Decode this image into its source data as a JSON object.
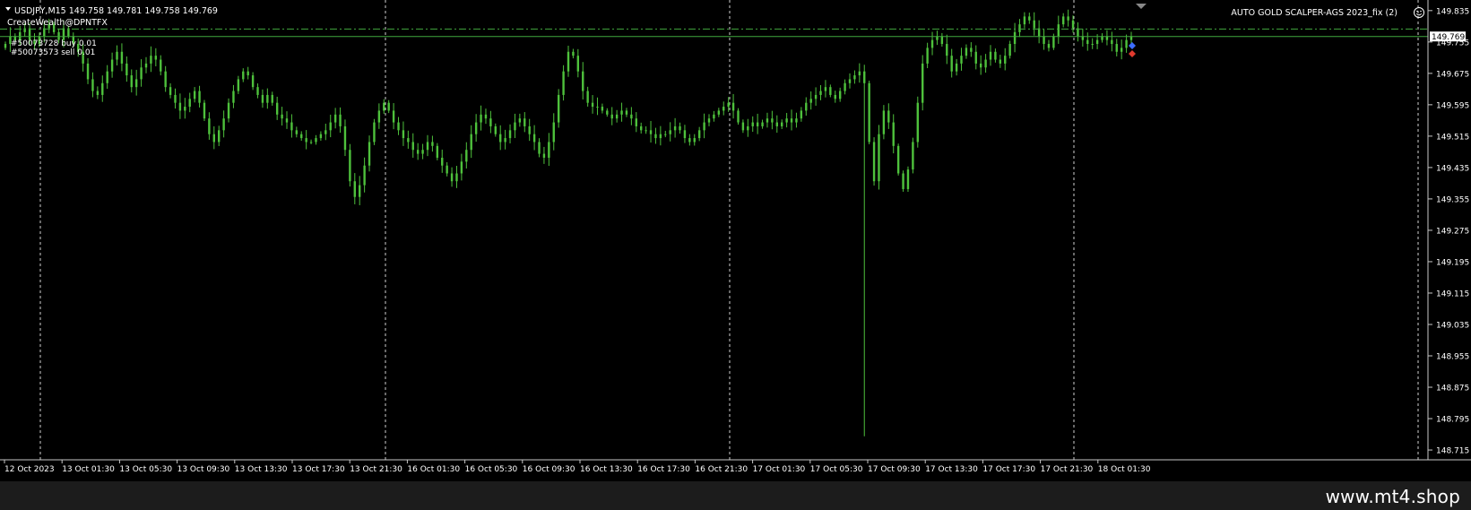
{
  "header": {
    "symbol_line": "USDJPY,M15  149.758 149.781 149.758 149.769",
    "account_line": "CreateWealth@DPNTFX",
    "expert_name": "AUTO GOLD SCALPER-AGS 2023_fix (2)",
    "order_label_1": "#50073728 buy 0.01",
    "order_label_2": "#50073573 sell 0.01"
  },
  "watermark": "www.mt4.shop",
  "colors": {
    "background": "#000000",
    "candle": "#4ec13c",
    "grid": "#c8c8c8",
    "axis_text": "#ffffff",
    "price_line": "#41a83e",
    "price_tag_bg": "#ffffff",
    "price_tag_text": "#000000"
  },
  "chart_data": {
    "type": "candlestick",
    "title": "USDJPY,M15",
    "instrument": "USDJPY",
    "timeframe": "M15",
    "last_ohlc": {
      "open": 149.758,
      "high": 149.781,
      "low": 149.758,
      "close": 149.769
    },
    "current_price": 149.769,
    "current_price_label": "149.769",
    "order_lines": [
      {
        "label": "#50073728 buy 0.01",
        "price": 149.788
      },
      {
        "label": "#50073573 sell 0.01",
        "price": 149.769
      }
    ],
    "ylim": [
      148.69,
      149.862
    ],
    "y_ticks": [
      "149.835",
      "149.755",
      "149.675",
      "149.595",
      "149.515",
      "149.435",
      "149.355",
      "149.275",
      "149.195",
      "149.115",
      "149.035",
      "148.955",
      "148.875",
      "148.795",
      "148.715"
    ],
    "x_ticks": [
      "12 Oct 2023",
      "13 Oct 01:30",
      "13 Oct 05:30",
      "13 Oct 09:30",
      "13 Oct 13:30",
      "13 Oct 17:30",
      "13 Oct 21:30",
      "16 Oct 01:30",
      "16 Oct 05:30",
      "16 Oct 09:30",
      "16 Oct 13:30",
      "16 Oct 17:30",
      "16 Oct 21:30",
      "17 Oct 01:30",
      "17 Oct 05:30",
      "17 Oct 09:30",
      "17 Oct 13:30",
      "17 Oct 17:30",
      "17 Oct 21:30",
      "18 Oct 01:30"
    ],
    "grid": "vertical day separators",
    "close_path": [
      149.75,
      149.77,
      149.76,
      149.78,
      149.79,
      149.76,
      149.75,
      149.77,
      149.79,
      149.8,
      149.78,
      149.76,
      149.79,
      149.77,
      149.75,
      149.73,
      149.7,
      149.66,
      149.63,
      149.62,
      149.65,
      149.68,
      149.71,
      149.73,
      149.7,
      149.67,
      149.64,
      149.66,
      149.69,
      149.7,
      149.72,
      149.71,
      149.68,
      149.64,
      149.62,
      149.6,
      149.58,
      149.59,
      149.61,
      149.63,
      149.6,
      149.56,
      149.52,
      149.5,
      149.53,
      149.56,
      149.6,
      149.63,
      149.66,
      149.68,
      149.67,
      149.64,
      149.62,
      149.6,
      149.62,
      149.6,
      149.57,
      149.56,
      149.55,
      149.53,
      149.52,
      149.51,
      149.5,
      149.5,
      149.51,
      149.52,
      149.53,
      149.55,
      149.57,
      149.54,
      149.48,
      149.4,
      149.36,
      149.39,
      149.44,
      149.5,
      149.55,
      149.58,
      149.6,
      149.58,
      149.55,
      149.53,
      149.51,
      149.5,
      149.48,
      149.47,
      149.48,
      149.5,
      149.49,
      149.46,
      149.44,
      149.42,
      149.4,
      149.42,
      149.45,
      149.48,
      149.52,
      149.55,
      149.57,
      149.56,
      149.54,
      149.52,
      149.5,
      149.51,
      149.53,
      149.55,
      149.56,
      149.54,
      149.52,
      149.5,
      149.47,
      149.46,
      149.5,
      149.55,
      149.62,
      149.68,
      149.73,
      149.72,
      149.68,
      149.63,
      149.6,
      149.59,
      149.59,
      149.58,
      149.57,
      149.56,
      149.57,
      149.58,
      149.57,
      149.56,
      149.54,
      149.53,
      149.53,
      149.52,
      149.51,
      149.52,
      149.52,
      149.53,
      149.54,
      149.53,
      149.51,
      149.5,
      149.51,
      149.53,
      149.55,
      149.56,
      149.57,
      149.58,
      149.59,
      149.6,
      149.58,
      149.55,
      149.53,
      149.54,
      149.55,
      149.54,
      149.55,
      149.56,
      149.55,
      149.54,
      149.55,
      149.56,
      149.55,
      149.56,
      149.58,
      149.6,
      149.61,
      149.62,
      149.63,
      149.64,
      149.62,
      149.61,
      149.63,
      149.65,
      149.66,
      149.67,
      149.68,
      149.65,
      149.5,
      149.4,
      149.52,
      149.58,
      149.55,
      149.49,
      149.42,
      149.38,
      149.43,
      149.5,
      149.6,
      149.7,
      149.74,
      149.76,
      149.77,
      149.75,
      149.72,
      149.68,
      149.7,
      149.72,
      149.74,
      149.73,
      149.7,
      149.69,
      149.71,
      149.73,
      149.71,
      149.7,
      149.72,
      149.75,
      149.78,
      149.8,
      149.82,
      149.81,
      149.79,
      149.77,
      149.75,
      149.74,
      149.77,
      149.8,
      149.82,
      149.81,
      149.79,
      149.77,
      149.76,
      149.75,
      149.75,
      149.76,
      149.77,
      149.76,
      149.75,
      149.73,
      149.74,
      149.76,
      149.77
    ],
    "spike_low": 148.75
  }
}
